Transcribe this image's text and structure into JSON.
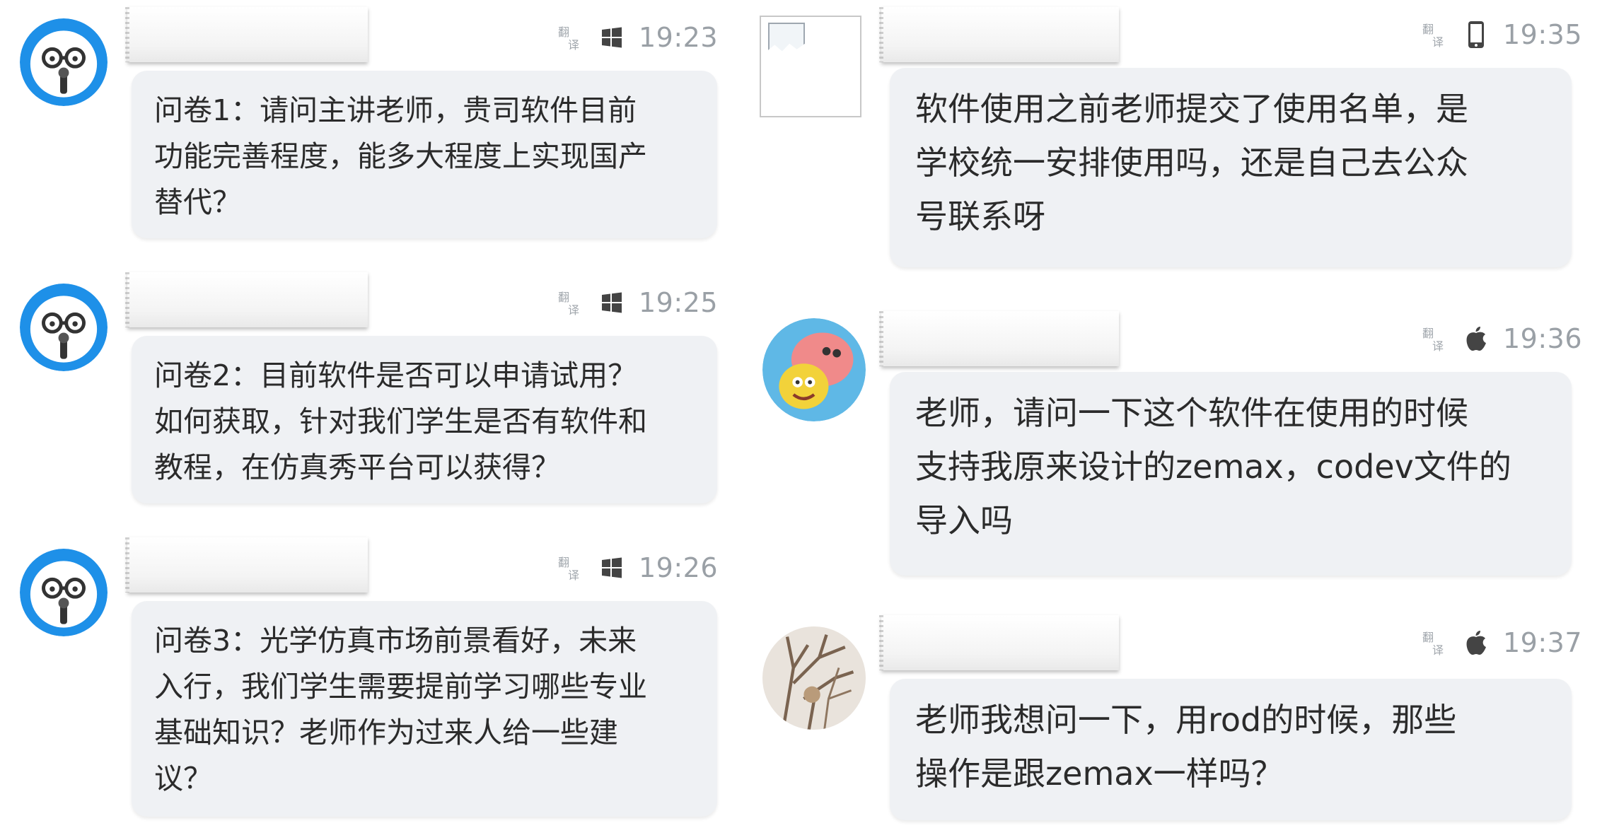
{
  "left_messages": [
    {
      "time": "19:23",
      "platform_icon": "windows-icon",
      "text": "问卷1：请问主讲老师，贵司软件目前\n功能完善程度，能多大程度上实现国产\n替代？"
    },
    {
      "time": "19:25",
      "platform_icon": "windows-icon",
      "text": "问卷2：目前软件是否可以申请试用？\n如何获取，针对我们学生是否有软件和\n教程，在仿真秀平台可以获得？"
    },
    {
      "time": "19:26",
      "platform_icon": "windows-icon",
      "text": "问卷3：光学仿真市场前景看好，未来\n入行，我们学生需要提前学习哪些专业\n基础知识？老师作为过来人给一些建\n议？"
    }
  ],
  "right_messages": [
    {
      "time": "19:35",
      "platform_icon": "mobile-phone-icon",
      "text": "软件使用之前老师提交了使用名单，是\n学校统一安排使用吗，还是自己去公众\n号联系呀"
    },
    {
      "time": "19:36",
      "platform_icon": "apple-icon",
      "text": "老师，请问一下这个软件在使用的时候\n支持我原来设计的zemax，codev文件的\n导入吗"
    },
    {
      "time": "19:37",
      "platform_icon": "apple-icon",
      "text": "老师我想问一下，用rod的时候，那些\n操作是跟zemax一样吗？"
    }
  ],
  "colors": {
    "bubble": "#eff1f4",
    "meta_text": "#9aa0a6",
    "avatar_blue": "#1e90e8"
  }
}
